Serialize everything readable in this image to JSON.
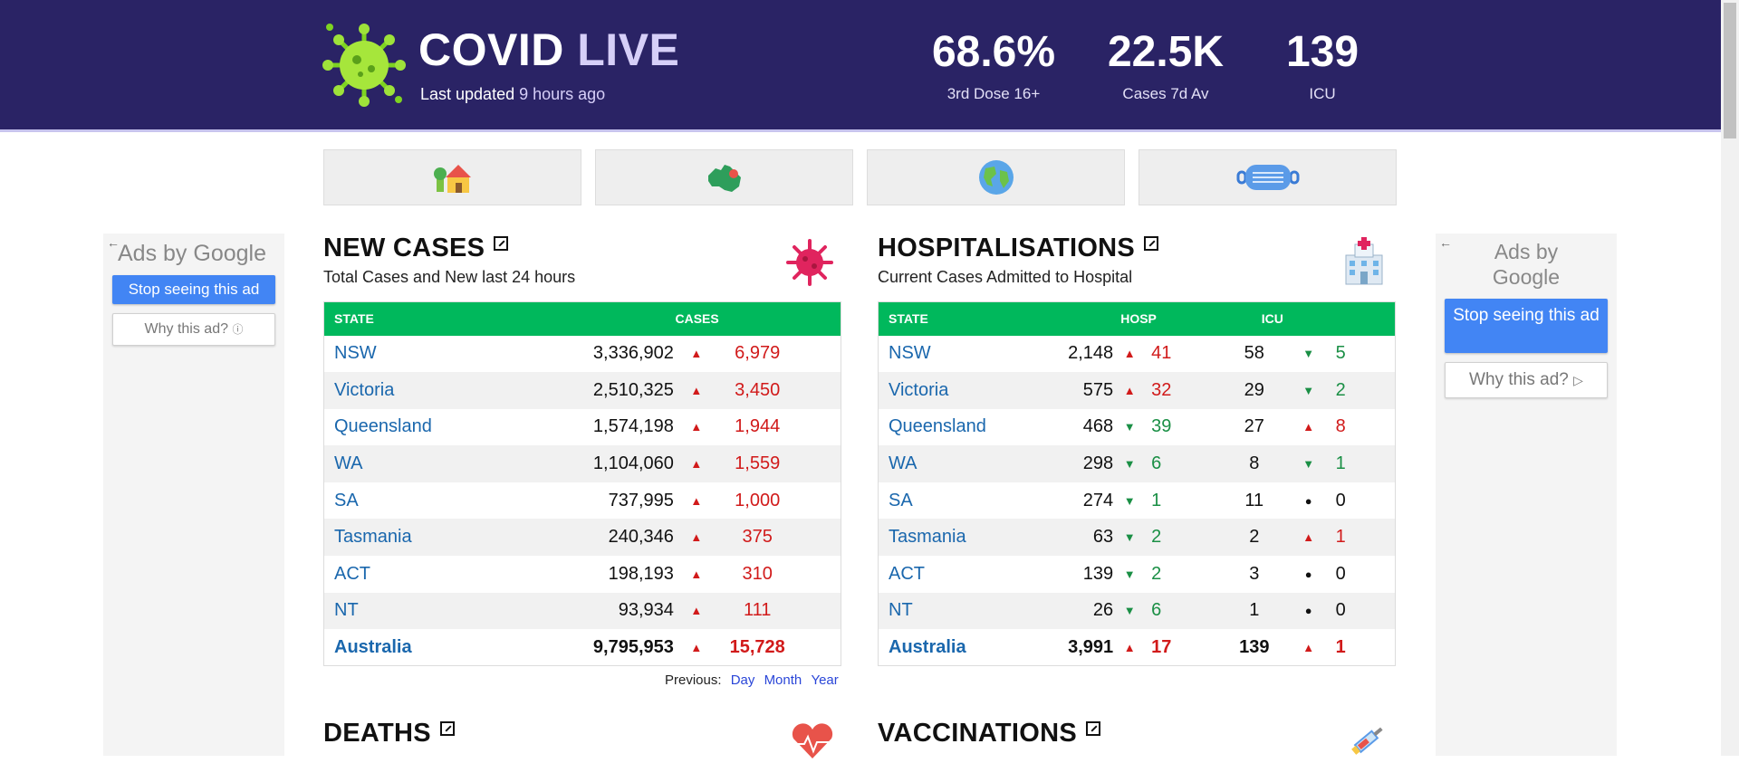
{
  "header": {
    "brand_main": "COVID",
    "brand_accent": "LIVE",
    "updated_label": "Last updated",
    "updated_ago": "9 hours ago",
    "stats": [
      {
        "value": "68.6%",
        "label": "3rd Dose 16+"
      },
      {
        "value": "22.5K",
        "label": "Cases 7d Av"
      },
      {
        "value": "139",
        "label": "ICU"
      }
    ]
  },
  "nav": [
    {
      "icon": "house-icon"
    },
    {
      "icon": "australia-map-icon"
    },
    {
      "icon": "globe-icon"
    },
    {
      "icon": "face-mask-icon"
    }
  ],
  "ads": {
    "left": {
      "ads_by": "Ads by",
      "google": "Google",
      "stop": "Stop seeing this ad",
      "why": "Why this ad?"
    },
    "right": {
      "ads_by": "Ads by",
      "google": "Google",
      "stop": "Stop seeing this ad",
      "why": "Why this ad?"
    }
  },
  "new_cases": {
    "title": "NEW CASES",
    "subtitle": "Total Cases and New last 24 hours",
    "headers": {
      "state": "STATE",
      "cases": "CASES"
    },
    "rows": [
      {
        "state": "NSW",
        "cases": "3,336,902",
        "dir": "up",
        "change": "6,979"
      },
      {
        "state": "Victoria",
        "cases": "2,510,325",
        "dir": "up",
        "change": "3,450"
      },
      {
        "state": "Queensland",
        "cases": "1,574,198",
        "dir": "up",
        "change": "1,944"
      },
      {
        "state": "WA",
        "cases": "1,104,060",
        "dir": "up",
        "change": "1,559"
      },
      {
        "state": "SA",
        "cases": "737,995",
        "dir": "up",
        "change": "1,000"
      },
      {
        "state": "Tasmania",
        "cases": "240,346",
        "dir": "up",
        "change": "375"
      },
      {
        "state": "ACT",
        "cases": "198,193",
        "dir": "up",
        "change": "310"
      },
      {
        "state": "NT",
        "cases": "93,934",
        "dir": "up",
        "change": "111"
      },
      {
        "state": "Australia",
        "cases": "9,795,953",
        "dir": "up",
        "change": "15,728"
      }
    ],
    "previous_label": "Previous:",
    "previous_links": [
      "Day",
      "Month",
      "Year"
    ]
  },
  "hospitalisations": {
    "title": "HOSPITALISATIONS",
    "subtitle": "Current Cases Admitted to Hospital",
    "headers": {
      "state": "STATE",
      "hosp": "HOSP",
      "icu": "ICU"
    },
    "rows": [
      {
        "state": "NSW",
        "hosp": "2,148",
        "hdir": "up",
        "hchg": "41",
        "icu": "58",
        "idir": "down",
        "ichg": "5"
      },
      {
        "state": "Victoria",
        "hosp": "575",
        "hdir": "up",
        "hchg": "32",
        "icu": "29",
        "idir": "down",
        "ichg": "2"
      },
      {
        "state": "Queensland",
        "hosp": "468",
        "hdir": "down",
        "hchg": "39",
        "icu": "27",
        "idir": "up",
        "ichg": "8"
      },
      {
        "state": "WA",
        "hosp": "298",
        "hdir": "down",
        "hchg": "6",
        "icu": "8",
        "idir": "down",
        "ichg": "1"
      },
      {
        "state": "SA",
        "hosp": "274",
        "hdir": "down",
        "hchg": "1",
        "icu": "11",
        "idir": "flat",
        "ichg": "0"
      },
      {
        "state": "Tasmania",
        "hosp": "63",
        "hdir": "down",
        "hchg": "2",
        "icu": "2",
        "idir": "up",
        "ichg": "1"
      },
      {
        "state": "ACT",
        "hosp": "139",
        "hdir": "down",
        "hchg": "2",
        "icu": "3",
        "idir": "flat",
        "ichg": "0"
      },
      {
        "state": "NT",
        "hosp": "26",
        "hdir": "down",
        "hchg": "6",
        "icu": "1",
        "idir": "flat",
        "ichg": "0"
      },
      {
        "state": "Australia",
        "hosp": "3,991",
        "hdir": "up",
        "hchg": "17",
        "icu": "139",
        "idir": "up",
        "ichg": "1"
      }
    ]
  },
  "deaths": {
    "title": "DEATHS"
  },
  "vaccinations": {
    "title": "VACCINATIONS"
  },
  "colors": {
    "header_bg": "#2a2365",
    "table_header": "#00b85c",
    "increase": "#d11a1a",
    "decrease": "#1a8f45",
    "link": "#1a67ad",
    "ad_button": "#4285f4"
  }
}
